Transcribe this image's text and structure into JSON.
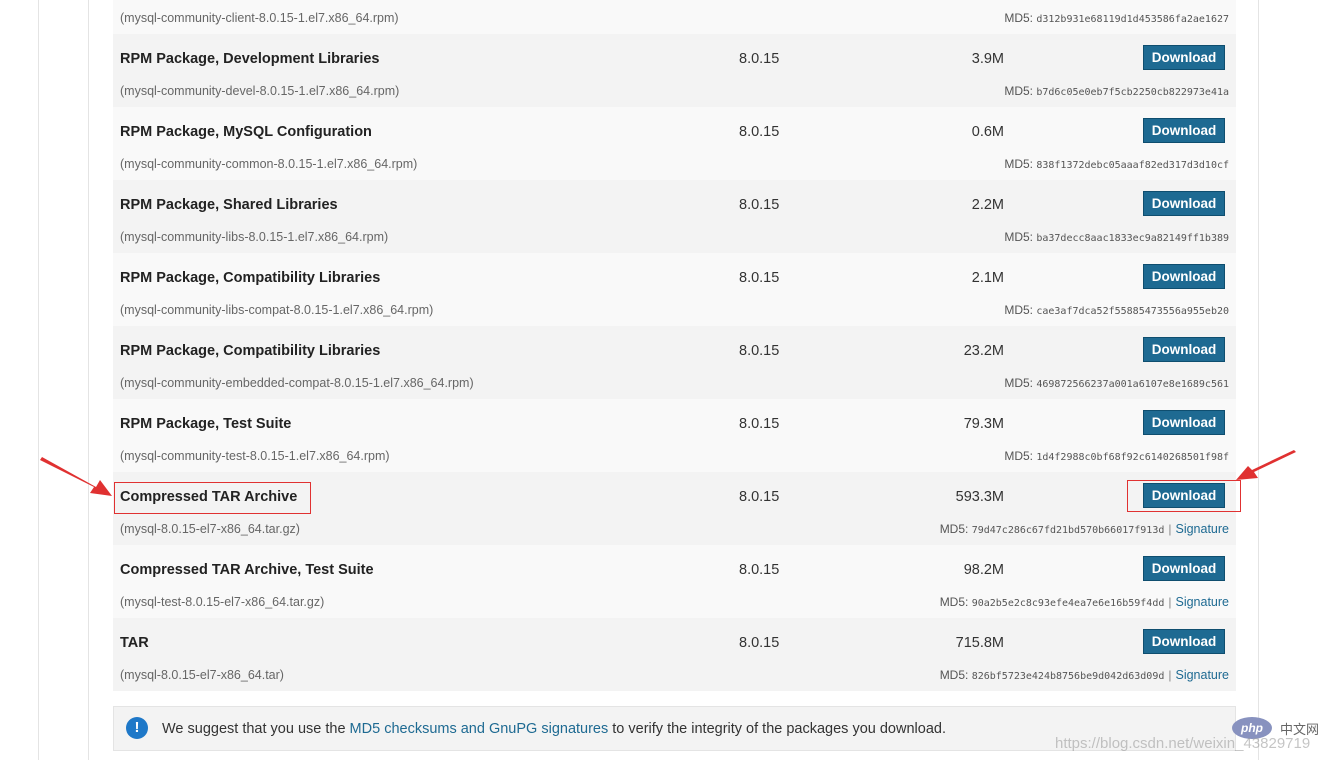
{
  "packages": [
    {
      "title": "",
      "version": "",
      "size": "",
      "file": "(mysql-community-client-8.0.15-1.el7.x86_64.rpm)",
      "md5_label": "MD5:",
      "md5": "d312b931e68119d1d453586fa2ae1627",
      "download": "",
      "signature": ""
    },
    {
      "title": "RPM Package, Development Libraries",
      "version": "8.0.15",
      "size": "3.9M",
      "file": "(mysql-community-devel-8.0.15-1.el7.x86_64.rpm)",
      "md5_label": "MD5:",
      "md5": "b7d6c05e0eb7f5cb2250cb822973e41a",
      "download": "Download",
      "signature": ""
    },
    {
      "title": "RPM Package, MySQL Configuration",
      "version": "8.0.15",
      "size": "0.6M",
      "file": "(mysql-community-common-8.0.15-1.el7.x86_64.rpm)",
      "md5_label": "MD5:",
      "md5": "838f1372debc05aaaf82ed317d3d10cf",
      "download": "Download",
      "signature": ""
    },
    {
      "title": "RPM Package, Shared Libraries",
      "version": "8.0.15",
      "size": "2.2M",
      "file": "(mysql-community-libs-8.0.15-1.el7.x86_64.rpm)",
      "md5_label": "MD5:",
      "md5": "ba37decc8aac1833ec9a82149ff1b389",
      "download": "Download",
      "signature": ""
    },
    {
      "title": "RPM Package, Compatibility Libraries",
      "version": "8.0.15",
      "size": "2.1M",
      "file": "(mysql-community-libs-compat-8.0.15-1.el7.x86_64.rpm)",
      "md5_label": "MD5:",
      "md5": "cae3af7dca52f55885473556a955eb20",
      "download": "Download",
      "signature": ""
    },
    {
      "title": "RPM Package, Compatibility Libraries",
      "version": "8.0.15",
      "size": "23.2M",
      "file": "(mysql-community-embedded-compat-8.0.15-1.el7.x86_64.rpm)",
      "md5_label": "MD5:",
      "md5": "469872566237a001a6107e8e1689c561",
      "download": "Download",
      "signature": ""
    },
    {
      "title": "RPM Package, Test Suite",
      "version": "8.0.15",
      "size": "79.3M",
      "file": "(mysql-community-test-8.0.15-1.el7.x86_64.rpm)",
      "md5_label": "MD5:",
      "md5": "1d4f2988c0bf68f92c6140268501f98f",
      "download": "Download",
      "signature": ""
    },
    {
      "title": "Compressed TAR Archive",
      "version": "8.0.15",
      "size": "593.3M",
      "file": "(mysql-8.0.15-el7-x86_64.tar.gz)",
      "md5_label": "MD5:",
      "md5": "79d47c286c67fd21bd570b66017f913d",
      "download": "Download",
      "signature": "Signature"
    },
    {
      "title": "Compressed TAR Archive, Test Suite",
      "version": "8.0.15",
      "size": "98.2M",
      "file": "(mysql-test-8.0.15-el7-x86_64.tar.gz)",
      "md5_label": "MD5:",
      "md5": "90a2b5e2c8c93efe4ea7e6e16b59f4dd",
      "download": "Download",
      "signature": "Signature"
    },
    {
      "title": "TAR",
      "version": "8.0.15",
      "size": "715.8M",
      "file": "(mysql-8.0.15-el7-x86_64.tar)",
      "md5_label": "MD5:",
      "md5": "826bf5723e424b8756be9d042d63d09d",
      "download": "Download",
      "signature": "Signature"
    }
  ],
  "note": {
    "icon": "info-icon",
    "text_before": "We suggest that you use the ",
    "link": "MD5 checksums and GnuPG signatures",
    "text_after": " to verify the integrity of the packages you download."
  },
  "overlay": {
    "watermark": "https://blog.csdn.net/weixin_43829719",
    "php_logo": "php",
    "php_cn": "中文网",
    "annotation_color": "#e03131"
  },
  "colors": {
    "button": "#1e6a92",
    "link": "#1e6a92",
    "row_shaded": "#f3f3f3"
  }
}
